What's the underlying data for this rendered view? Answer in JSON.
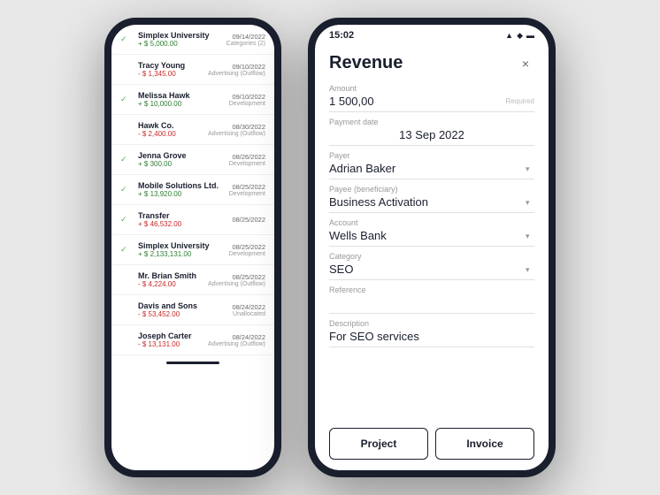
{
  "scene": {
    "background": "#e8e8e8"
  },
  "left_phone": {
    "transactions": [
      {
        "name": "Simplex University",
        "date": "09/14/2022",
        "amount": "+ $ 5,000.00",
        "type": "positive",
        "category": "Categories (2)",
        "checked": true
      },
      {
        "name": "Tracy Young",
        "date": "09/10/2022",
        "amount": "- $ 1,345.00",
        "type": "negative",
        "category": "Advertising (Outflow)",
        "checked": true
      },
      {
        "name": "Melissa Hawk",
        "date": "09/10/2022",
        "amount": "+ $ 10,000.00",
        "type": "positive",
        "category": "Development",
        "checked": true
      },
      {
        "name": "Hawk Co.",
        "date": "08/30/2022",
        "amount": "- $ 2,400.00",
        "type": "negative",
        "category": "Advertising (Outflow)",
        "checked": true
      },
      {
        "name": "Jenna Grove",
        "date": "08/26/2022",
        "amount": "+ $ 300.00",
        "type": "positive",
        "category": "Development",
        "checked": true
      },
      {
        "name": "Mobile Solutions Ltd.",
        "date": "08/25/2022",
        "amount": "+ $ 13,920.00",
        "type": "positive",
        "category": "Development",
        "checked": true
      },
      {
        "name": "Transfer",
        "date": "08/25/2022",
        "amount": "+ $ 46,532.00",
        "type": "negative",
        "category": "",
        "checked": true
      },
      {
        "name": "Simplex University",
        "date": "08/25/2022",
        "amount": "+ $ 2,133,131.00",
        "type": "positive",
        "category": "Development",
        "checked": true
      },
      {
        "name": "Mr. Brian Smith",
        "date": "08/25/2022",
        "amount": "- $ 4,224.00",
        "type": "negative",
        "category": "Advertising (Outflow)",
        "checked": true
      },
      {
        "name": "Davis and Sons",
        "date": "08/24/2022",
        "amount": "- $ 53,452.00",
        "type": "negative",
        "category": "Unallocated",
        "checked": true
      },
      {
        "name": "Joseph Carter",
        "date": "08/24/2022",
        "amount": "- $ 13,131.00",
        "type": "negative",
        "category": "Advertising (Outflow)",
        "checked": true
      }
    ]
  },
  "right_phone": {
    "status_bar": {
      "time": "15:02",
      "signal": "▲",
      "wifi": "◆",
      "battery": "▬"
    },
    "form": {
      "title": "Revenue",
      "close_label": "×",
      "fields": {
        "amount_label": "Amount",
        "amount_value": "1 500,00",
        "amount_required": "Required",
        "payment_date_label": "Payment date",
        "payment_date_value": "13 Sep 2022",
        "payer_label": "Payer",
        "payer_value": "Adrian Baker",
        "payee_label": "Payee (beneficiary)",
        "payee_value": "Business Activation",
        "account_label": "Account",
        "account_value": "Wells Bank",
        "category_label": "Category",
        "category_value": "SEO",
        "reference_label": "Reference",
        "reference_placeholder": "",
        "description_label": "Description",
        "description_value": "For SEO services"
      },
      "footer": {
        "project_label": "Project",
        "invoice_label": "Invoice"
      }
    }
  }
}
